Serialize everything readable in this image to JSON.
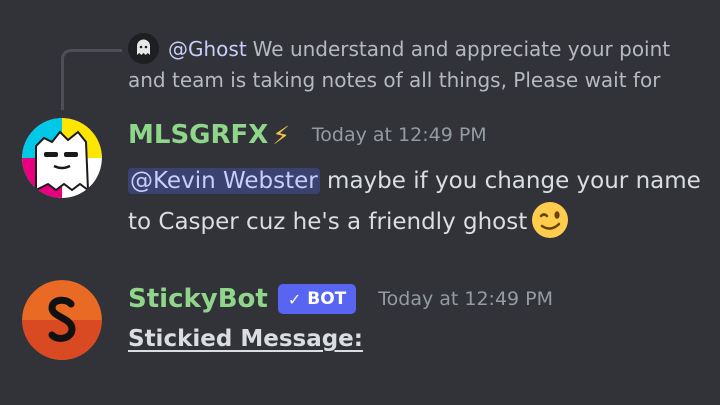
{
  "reply": {
    "mention": "@Ghost",
    "text": "We understand and appreciate your point and team is taking notes of all things, Please wait for"
  },
  "messages": [
    {
      "username": "MLSGRFX",
      "username_color": "#8fd68b",
      "flair_icon": "lightning-bolt-icon",
      "timestamp": "Today at 12:49 PM",
      "mention": "@Kevin Webster",
      "text": " maybe if you change your name to Casper cuz he's a friendly ghost",
      "emoji": "winking-face-emoji"
    },
    {
      "username": "StickyBot",
      "username_color": "#8fd68b",
      "badge": "BOT",
      "timestamp": "Today at 12:49 PM",
      "text": "Stickied Message:"
    }
  ],
  "colors": {
    "background": "#313338",
    "mention_bg": "#3c4270",
    "mention_fg": "#c9cdfb",
    "bot_badge": "#5865f2"
  }
}
